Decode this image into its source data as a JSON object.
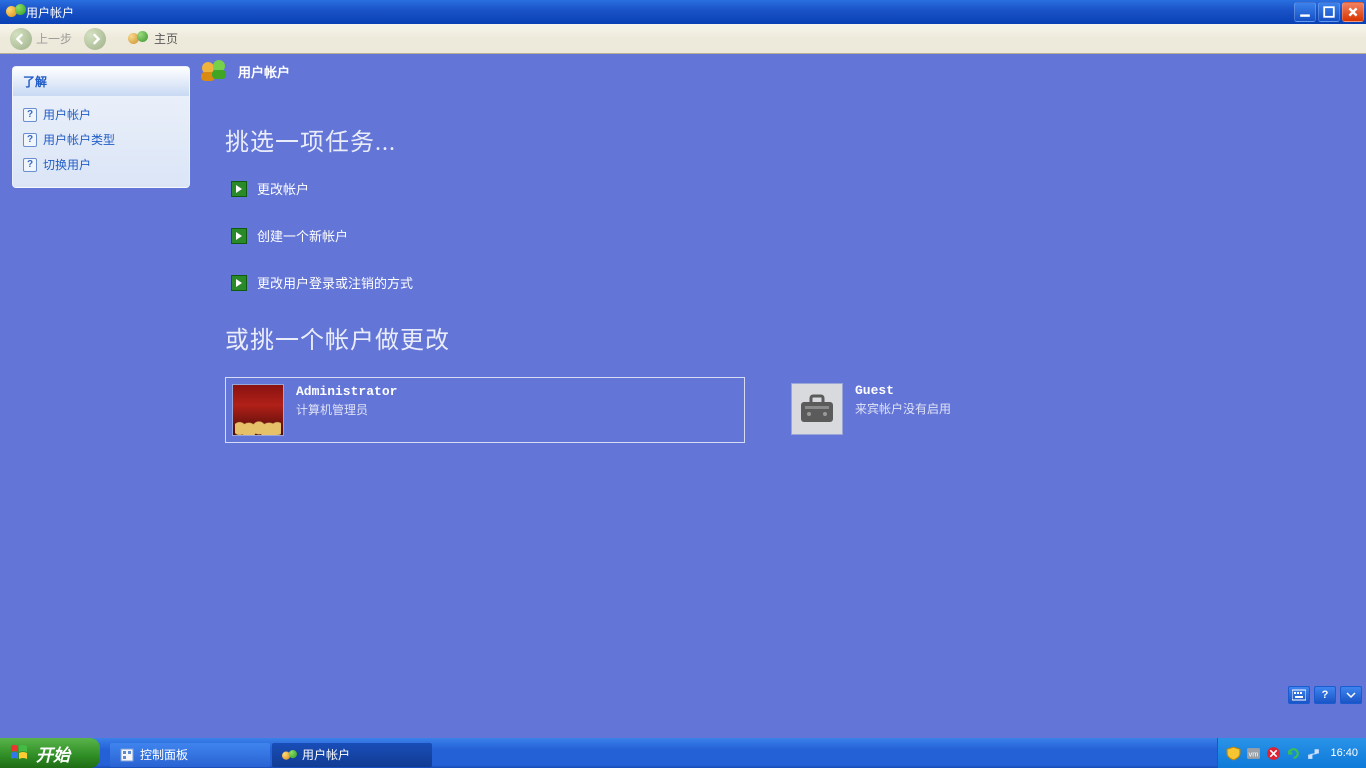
{
  "window": {
    "title": "用户帐户"
  },
  "toolbar": {
    "back": "上一步",
    "home": "主页"
  },
  "sidebar": {
    "header": "了解",
    "items": [
      {
        "label": "用户帐户"
      },
      {
        "label": "用户帐户类型"
      },
      {
        "label": "切换用户"
      }
    ]
  },
  "main": {
    "header": "用户帐户",
    "task_heading": "挑选一项任务...",
    "tasks": [
      {
        "label": "更改帐户"
      },
      {
        "label": "创建一个新帐户"
      },
      {
        "label": "更改用户登录或注销的方式"
      }
    ],
    "pick_heading": "或挑一个帐户做更改",
    "accounts": [
      {
        "name": "Administrator",
        "sub": "计算机管理员"
      },
      {
        "name": "Guest",
        "sub": "来宾帐户没有启用"
      }
    ]
  },
  "taskbar": {
    "start": "开始",
    "tasks": [
      {
        "label": "控制面板",
        "active": false
      },
      {
        "label": "用户帐户",
        "active": true
      }
    ],
    "clock": "16:40"
  }
}
